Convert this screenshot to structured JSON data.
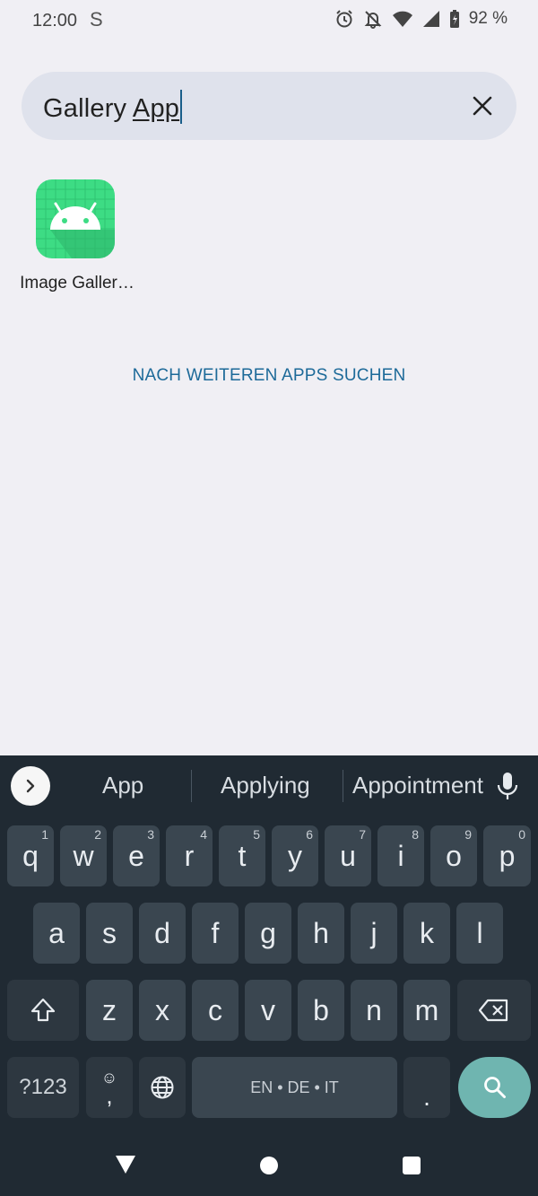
{
  "status_bar": {
    "time": "12:00",
    "sim_glyph": "S",
    "battery": "92 %",
    "icons": [
      "alarm-icon",
      "bell-off-icon",
      "wifi-icon",
      "signal-icon",
      "battery-charging-icon"
    ]
  },
  "search": {
    "text_prefix": "Gallery ",
    "text_composing": "App",
    "clear_icon": "close-icon"
  },
  "results": [
    {
      "label": "Image Galler…",
      "icon": "android-app-icon",
      "icon_color": "#3ddc84"
    }
  ],
  "more_apps_label": "NACH WEITEREN APPS SUCHEN",
  "keyboard": {
    "suggestions": [
      "App",
      "Applying",
      "Appointment"
    ],
    "row1": [
      {
        "k": "q",
        "h": "1"
      },
      {
        "k": "w",
        "h": "2"
      },
      {
        "k": "e",
        "h": "3"
      },
      {
        "k": "r",
        "h": "4"
      },
      {
        "k": "t",
        "h": "5"
      },
      {
        "k": "y",
        "h": "6"
      },
      {
        "k": "u",
        "h": "7"
      },
      {
        "k": "i",
        "h": "8"
      },
      {
        "k": "o",
        "h": "9"
      },
      {
        "k": "p",
        "h": "0"
      }
    ],
    "row2": [
      "a",
      "s",
      "d",
      "f",
      "g",
      "h",
      "j",
      "k",
      "l"
    ],
    "row3": [
      "z",
      "x",
      "c",
      "v",
      "b",
      "n",
      "m"
    ],
    "symbols_label": "?123",
    "emoji_glyph": "☺",
    "comma_label": ",",
    "space_label": "EN • DE • IT",
    "period_label": ".",
    "accent_color": "#6fb5b0"
  },
  "nav": {
    "back_icon": "back-triangle-icon",
    "home_icon": "home-circle-icon",
    "recents_icon": "recents-square-icon"
  }
}
